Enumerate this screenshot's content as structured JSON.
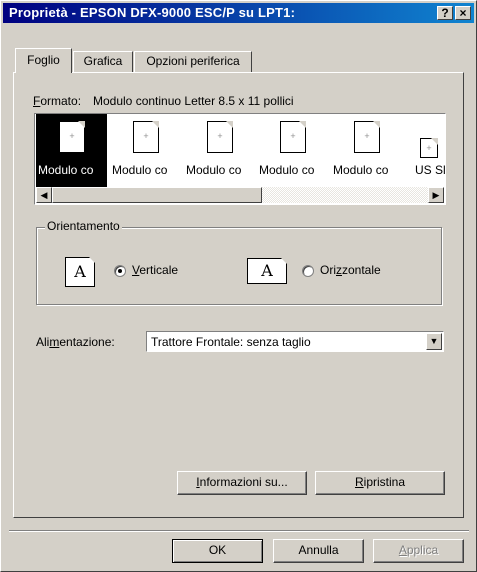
{
  "window": {
    "title": "Proprietà - EPSON DFX-9000 ESC/P su LPT1:",
    "help_button": "?",
    "close_button": "×"
  },
  "tabs": [
    {
      "label": "Foglio",
      "active": true
    },
    {
      "label": "Grafica",
      "active": false
    },
    {
      "label": "Opzioni periferica",
      "active": false
    }
  ],
  "format": {
    "label_mnemonic": "F",
    "label_rest": "ormato:",
    "value": "Modulo continuo Letter 8.5 x 11 pollici"
  },
  "paper_list": {
    "items": [
      {
        "label": "Modulo co",
        "selected": true
      },
      {
        "label": "Modulo co",
        "selected": false
      },
      {
        "label": "Modulo co",
        "selected": false
      },
      {
        "label": "Modulo co",
        "selected": false
      },
      {
        "label": "Modulo co",
        "selected": false
      },
      {
        "label": "US Sl",
        "selected": false
      }
    ],
    "scroll_left": "◀",
    "scroll_right": "▶"
  },
  "orientation": {
    "legend": "Orientamento",
    "icon_glyph": "A",
    "portrait": {
      "mnemonic": "V",
      "rest": "erticale",
      "selected": true
    },
    "landscape": {
      "pre": "Ori",
      "mnemonic": "z",
      "rest": "zontale",
      "selected": false
    }
  },
  "feed": {
    "label_pre": "Ali",
    "label_mnemonic": "m",
    "label_rest": "entazione:",
    "value": "Trattore Frontale: senza taglio",
    "arrow": "▼"
  },
  "buttons": {
    "info": {
      "mnemonic": "I",
      "rest": "nformazioni su..."
    },
    "reset": {
      "mnemonic": "R",
      "rest": "ipristina"
    },
    "ok": "OK",
    "cancel": "Annulla",
    "apply": {
      "mnemonic": "A",
      "rest": "pplica",
      "enabled": false
    }
  }
}
